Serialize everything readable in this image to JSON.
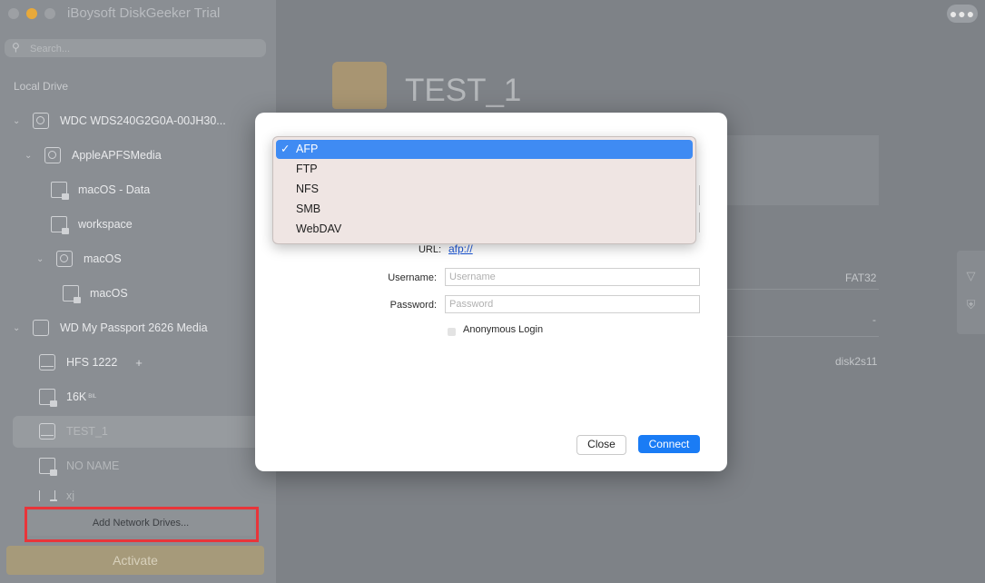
{
  "app": {
    "title": "iBoysoft DiskGeeker Trial",
    "more_label": "●●●"
  },
  "sidebar": {
    "search_placeholder": "Search...",
    "section_label": "Local Drive",
    "items": [
      {
        "label": "WDC WDS240G2G0A-00JH30..."
      },
      {
        "label": "AppleAPFSMedia"
      },
      {
        "label": "macOS - Data"
      },
      {
        "label": "workspace"
      },
      {
        "label": "macOS"
      },
      {
        "label": "macOS"
      },
      {
        "label": "WD My Passport 2626 Media"
      },
      {
        "label": "HFS 1222",
        "extra": "+"
      },
      {
        "label": "16K",
        "extra": "BIL"
      },
      {
        "label": "TEST_1"
      },
      {
        "label": "NO NAME"
      },
      {
        "label": "xj"
      }
    ],
    "add_network_label": "Add Network Drives...",
    "activate_label": "Activate"
  },
  "main": {
    "drive_title": "TEST_1",
    "info": {
      "format": "FAT32",
      "dash": "-",
      "device": "disk2s11"
    }
  },
  "dialog": {
    "url_label": "URL:",
    "url_value": "afp://",
    "username_label": "Username:",
    "username_placeholder": "Username",
    "password_label": "Password:",
    "password_placeholder": "Password",
    "anonymous_label": "Anonymous Login",
    "close_label": "Close",
    "connect_label": "Connect"
  },
  "dropdown": {
    "check": "✓",
    "options": [
      "AFP",
      "FTP",
      "NFS",
      "SMB",
      "WebDAV"
    ],
    "selected": "AFP"
  },
  "colors": {
    "accent": "#1a7cf5",
    "highlight": "#e8353a",
    "selection": "#3f8bf3"
  }
}
